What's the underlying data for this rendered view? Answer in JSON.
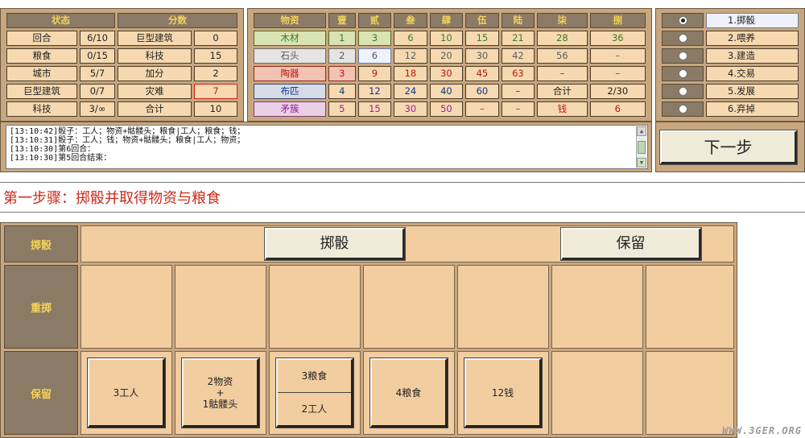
{
  "status": {
    "header_state": "状态",
    "header_score": "分数",
    "rows": [
      {
        "label": "回合",
        "value": "6/10",
        "score_label": "巨型建筑",
        "score": "0"
      },
      {
        "label": "粮食",
        "value": "0/15",
        "score_label": "科技",
        "score": "15"
      },
      {
        "label": "城市",
        "value": "5/7",
        "score_label": "加分",
        "score": "2"
      },
      {
        "label": "巨型建筑",
        "value": "0/7",
        "score_label": "灾难",
        "score": "7"
      },
      {
        "label": "科技",
        "value": "3/∞",
        "score_label": "合计",
        "score": "10"
      }
    ]
  },
  "goods": {
    "headers": [
      "物资",
      "壹",
      "贰",
      "叁",
      "肆",
      "伍",
      "陆",
      "柒",
      "捌"
    ],
    "rows": [
      {
        "name": "木材",
        "cells": [
          "1",
          "3",
          "6",
          "10",
          "15",
          "21",
          "28",
          "36"
        ]
      },
      {
        "name": "石头",
        "cells": [
          "2",
          "6",
          "12",
          "20",
          "30",
          "42",
          "56",
          "–"
        ]
      },
      {
        "name": "陶器",
        "cells": [
          "3",
          "9",
          "18",
          "30",
          "45",
          "63",
          "–",
          "–"
        ]
      },
      {
        "name": "布匹",
        "cells": [
          "4",
          "12",
          "24",
          "40",
          "60",
          "–",
          "合计",
          "2/30"
        ]
      },
      {
        "name": "矛簇",
        "cells": [
          "5",
          "15",
          "30",
          "50",
          "–",
          "–",
          "钱",
          "6"
        ]
      }
    ]
  },
  "actions": {
    "items": [
      "1.掷骰",
      "2.喂养",
      "3.建造",
      "4.交易",
      "5.发展",
      "6.弃掉"
    ],
    "selected": 0
  },
  "log": {
    "lines": [
      "[13:10:42]骰子：工人；物资+骷髅头；粮食|工人；粮食；钱；",
      "[13:10:31]骰子：工人；钱；物资+骷髅头；粮食|工人；物资；",
      "[13:10:30]第6回合：",
      "[13:10:30]第5回合结束："
    ]
  },
  "next_button": "下一步",
  "step_title": "第一步骤：掷骰并取得物资与粮食",
  "board": {
    "row_roll": "掷骰",
    "row_reroll": "重掷",
    "row_keep": "保留",
    "roll_button": "掷骰",
    "keep_button": "保留",
    "kept_dice": [
      {
        "type": "single",
        "text": "3工人"
      },
      {
        "type": "triple",
        "line1": "2物资",
        "line2": "+",
        "line3": "1骷髅头"
      },
      {
        "type": "split",
        "top": "3粮食",
        "bottom": "2工人"
      },
      {
        "type": "single",
        "text": "4粮食"
      },
      {
        "type": "single",
        "text": "12钱"
      }
    ]
  },
  "watermark": "WWW.3GER.ORG"
}
